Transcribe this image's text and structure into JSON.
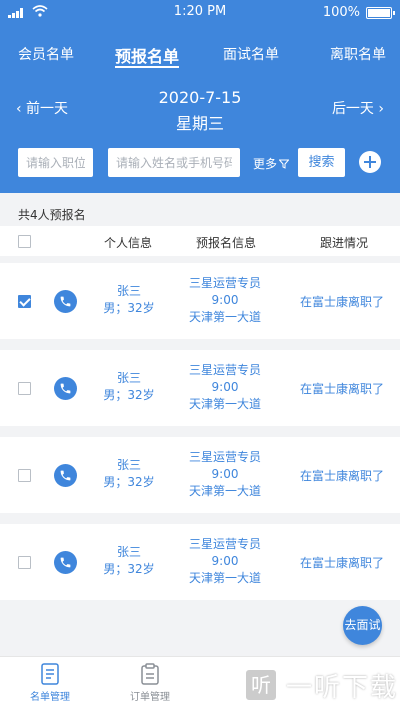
{
  "status_bar": {
    "time": "1:20 PM",
    "battery": "100%"
  },
  "tabs": [
    {
      "label": "会员名单"
    },
    {
      "label": "预报名单"
    },
    {
      "label": "面试名单"
    },
    {
      "label": "离职名单"
    }
  ],
  "date_nav": {
    "prev_label": "‹ 前一天",
    "next_label": "后一天 ›",
    "date": "2020-7-15",
    "weekday": "星期三"
  },
  "filters": {
    "position_placeholder": "请输入职位",
    "keyword_placeholder": "请输入姓名或手机号码",
    "more_label": "更多",
    "search_label": "搜索"
  },
  "count_text": "共4人预报名",
  "columns": [
    "个人信息",
    "预报名信息",
    "跟进情况"
  ],
  "rows": [
    {
      "checked": true,
      "name": "张三",
      "info": "男；32岁",
      "signup_job": "三星运营专员",
      "signup_time": "9:00",
      "signup_address": "天津第一大道",
      "follow": "在富士康离职了"
    },
    {
      "checked": false,
      "name": "张三",
      "info": "男；32岁",
      "signup_job": "三星运营专员",
      "signup_time": "9:00",
      "signup_address": "天津第一大道",
      "follow": "在富士康离职了"
    },
    {
      "checked": false,
      "name": "张三",
      "info": "男；32岁",
      "signup_job": "三星运营专员",
      "signup_time": "9:00",
      "signup_address": "天津第一大道",
      "follow": "在富士康离职了"
    },
    {
      "checked": false,
      "name": "张三",
      "info": "男；32岁",
      "signup_job": "三星运营专员",
      "signup_time": "9:00",
      "signup_address": "天津第一大道",
      "follow": "在富士康离职了"
    }
  ],
  "float_button": "去面试",
  "bottom_nav": [
    {
      "label": "名单管理"
    },
    {
      "label": "订单管理"
    }
  ],
  "watermark": {
    "logo": "听",
    "text": "一听下载"
  },
  "colors": {
    "primary": "#3f86dc",
    "background": "#f2f3f5"
  }
}
